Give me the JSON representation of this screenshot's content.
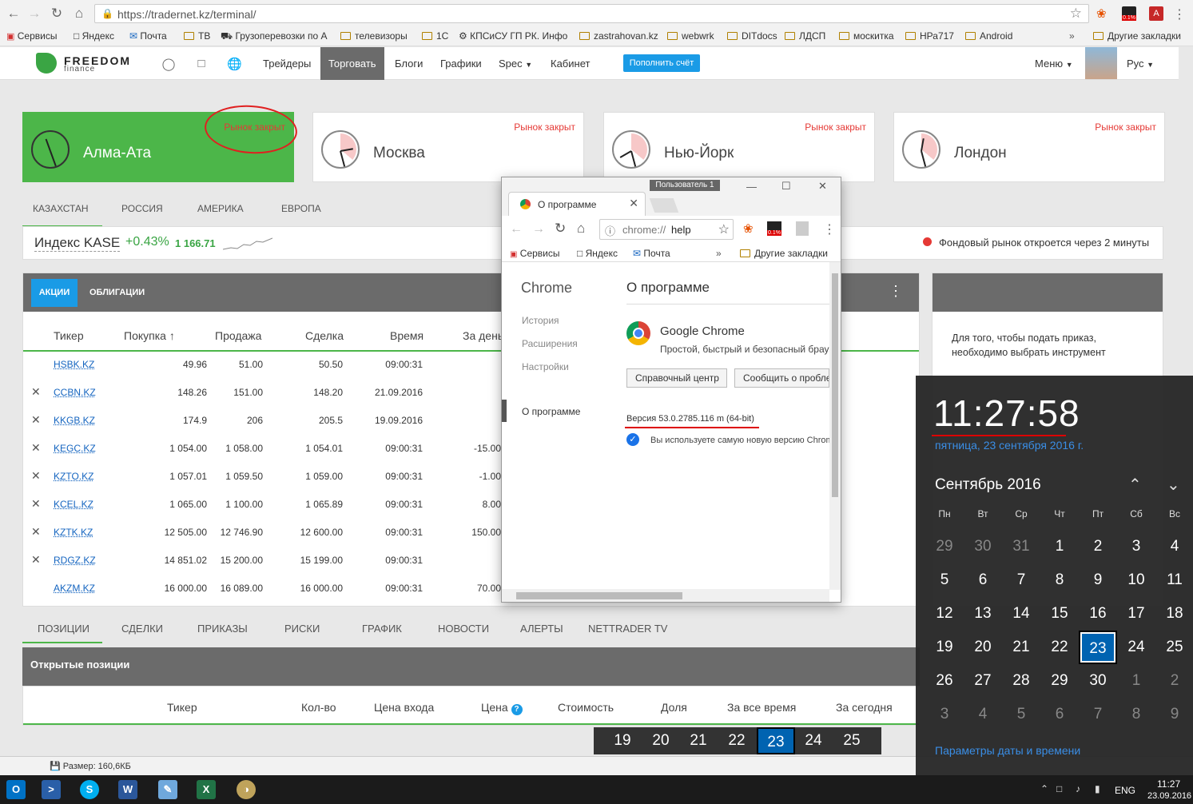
{
  "browser": {
    "url": "https://tradernet.kz/terminal/",
    "bookmarks": [
      "Сервисы",
      "Яндекс",
      "Почта",
      "ТВ",
      "Грузоперевозки по А",
      "телевизоры",
      "1С",
      "КПСиСУ ГП РК. Инфо",
      "zastrahovan.kz",
      "webwrk",
      "DITdocs",
      "ЛДСП",
      "москитка",
      "НРа717",
      "Android",
      "Другие закладки"
    ],
    "ext_badge": "0.1%"
  },
  "site": {
    "logo_line1": "FREEDOM",
    "logo_line2": "finance",
    "nav": [
      "Трейдеры",
      "Торговать",
      "Блоги",
      "Графики",
      "Spec",
      "Кабинет"
    ],
    "nav_active": "Торговать",
    "topup": "Пополнить счёт",
    "menu": "Меню",
    "lang": "Рус"
  },
  "clocks": [
    {
      "city": "Алма-Ата",
      "status": "Рынок закрыт",
      "open": true
    },
    {
      "city": "Москва",
      "status": "Рынок закрыт",
      "open": false
    },
    {
      "city": "Нью-Йорк",
      "status": "Рынок закрыт",
      "open": false
    },
    {
      "city": "Лондон",
      "status": "Рынок закрыт",
      "open": false
    }
  ],
  "market_tabs": [
    "КАЗАХСТАН",
    "РОССИЯ",
    "АМЕРИКА",
    "ЕВРОПА"
  ],
  "index": {
    "name": "Индекс KASE",
    "change": "+0.43%",
    "value": "1 166.71",
    "notice": "Фондовый рынок откроется через 2 минуты"
  },
  "stocks": {
    "tabs": [
      "АКЦИИ",
      "ОБЛИГАЦИИ"
    ],
    "columns": [
      "Тикер",
      "Покупка ↑",
      "Продажа",
      "Сделка",
      "Время",
      "За день"
    ],
    "rows": [
      {
        "ticker": "HSBK.KZ",
        "buy": "49.96",
        "sell": "51.00",
        "deal": "50.50",
        "time": "09:00:31",
        "day": "",
        "removable": false
      },
      {
        "ticker": "CCBN.KZ",
        "buy": "148.26",
        "sell": "151.00",
        "deal": "148.20",
        "time": "21.09.2016",
        "day": "",
        "removable": true
      },
      {
        "ticker": "KKGB.KZ",
        "buy": "174.9",
        "sell": "206",
        "deal": "205.5",
        "time": "19.09.2016",
        "day": "",
        "removable": true
      },
      {
        "ticker": "KEGC.KZ",
        "buy": "1 054.00",
        "sell": "1 058.00",
        "deal": "1 054.01",
        "time": "09:00:31",
        "day": "-15.00",
        "removable": true
      },
      {
        "ticker": "KZTO.KZ",
        "buy": "1 057.01",
        "sell": "1 059.50",
        "deal": "1 059.00",
        "time": "09:00:31",
        "day": "-1.00",
        "removable": true
      },
      {
        "ticker": "KCEL.KZ",
        "buy": "1 065.00",
        "sell": "1 100.00",
        "deal": "1 065.89",
        "time": "09:00:31",
        "day": "8.00",
        "removable": true
      },
      {
        "ticker": "KZTK.KZ",
        "buy": "12 505.00",
        "sell": "12 746.90",
        "deal": "12 600.00",
        "time": "09:00:31",
        "day": "150.00",
        "removable": true
      },
      {
        "ticker": "RDGZ.KZ",
        "buy": "14 851.02",
        "sell": "15 200.00",
        "deal": "15 199.00",
        "time": "09:00:31",
        "day": "",
        "removable": true
      },
      {
        "ticker": "AKZM.KZ",
        "buy": "16 000.00",
        "sell": "16 089.00",
        "deal": "16 000.00",
        "time": "09:00:31",
        "day": "70.00",
        "removable": false
      }
    ]
  },
  "right_panel": {
    "text": "Для того, чтобы подать приказ, необходимо выбрать инструмент"
  },
  "bottom_tabs": [
    "ПОЗИЦИИ",
    "СДЕЛКИ",
    "ПРИКАЗЫ",
    "РИСКИ",
    "ГРАФИК",
    "НОВОСТИ",
    "АЛЕРТЫ",
    "NETTRADER TV"
  ],
  "open_positions": {
    "title": "Открытые позиции",
    "columns": [
      "Тикер",
      "Кол-во",
      "Цена входа",
      "Цена",
      "Стоимость",
      "Доля",
      "За все время",
      "За сегодня"
    ]
  },
  "status_size": "Размер: 160,6КБ",
  "bottom_days": [
    "19",
    "20",
    "21",
    "22",
    "23",
    "24",
    "25"
  ],
  "about": {
    "tab_title": "О программе",
    "user": "Пользователь 1",
    "url_scheme": "chrome://",
    "url_path": "help",
    "bookmarks": [
      "Сервисы",
      "Яндекс",
      "Почта",
      "Другие закладки"
    ],
    "side_title": "Chrome",
    "side_items": [
      "История",
      "Расширения",
      "Настройки",
      "О программе"
    ],
    "heading": "О программе",
    "product": "Google Chrome",
    "tagline": "Простой, быстрый и безопасный браузер",
    "btn_help": "Справочный центр",
    "btn_report": "Сообщить о проблеме",
    "version": "Версия 53.0.2785.116 m (64-bit)",
    "uptodate": "Вы используете самую новую версию Chrome"
  },
  "calendar": {
    "time": "11:27:58",
    "date": "пятница, 23 сентября 2016 г.",
    "month": "Сентябрь 2016",
    "weekdays": [
      "Пн",
      "Вт",
      "Ср",
      "Чт",
      "Пт",
      "Сб",
      "Вс"
    ],
    "days": [
      [
        "29",
        "30",
        "31",
        "1",
        "2",
        "3",
        "4"
      ],
      [
        "5",
        "6",
        "7",
        "8",
        "9",
        "10",
        "11"
      ],
      [
        "12",
        "13",
        "14",
        "15",
        "16",
        "17",
        "18"
      ],
      [
        "19",
        "20",
        "21",
        "22",
        "23",
        "24",
        "25"
      ],
      [
        "26",
        "27",
        "28",
        "29",
        "30",
        "1",
        "2"
      ],
      [
        "3",
        "4",
        "5",
        "6",
        "7",
        "8",
        "9"
      ]
    ],
    "selected": "23",
    "settings": "Параметры даты и времени"
  },
  "taskbar": {
    "lang": "ENG",
    "time": "11:27",
    "date": "23.09.2016"
  }
}
